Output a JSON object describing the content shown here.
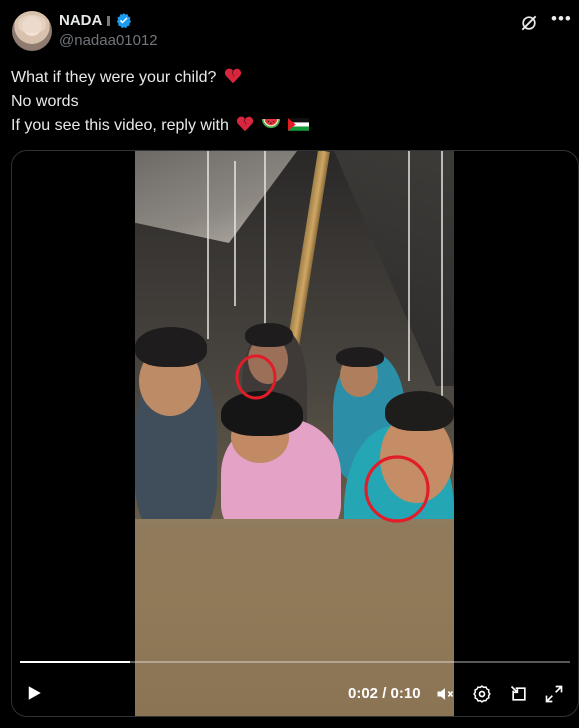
{
  "post": {
    "author_name": "NADA",
    "author_handle": "@nadaa01012",
    "verified_icon": "verified-badge-icon",
    "lines": [
      "What if they were your child?",
      "No words",
      "If you see this video, reply with"
    ],
    "emoji": {
      "line1": "broken-heart-icon",
      "line3": [
        "broken-heart-icon",
        "watermelon-icon",
        "palestine-flag-icon"
      ]
    }
  },
  "video": {
    "current_time": "0:02",
    "duration": "0:10",
    "time_display": "0:02 / 0:10",
    "progress_fraction": 0.2,
    "icons": [
      "play-icon",
      "mute-icon",
      "settings-icon",
      "picture-in-picture-icon",
      "fullscreen-icon"
    ]
  },
  "header_icons": [
    "grok-icon",
    "more-icon"
  ],
  "colors": {
    "background": "#000000",
    "text": "#e7e9ea",
    "secondary_text": "#71767b",
    "verified": "#1d9bf0",
    "border": "#2f3336",
    "annotation_red": "#e11d2a"
  }
}
